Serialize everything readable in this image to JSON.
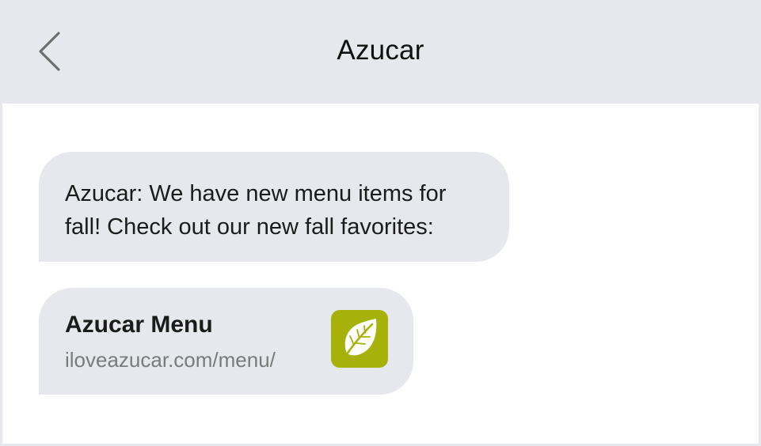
{
  "header": {
    "title": "Azucar",
    "back_icon": "chevron-left-icon"
  },
  "messages": [
    {
      "type": "text",
      "text": "Azucar: We have new menu items for fall! Check out our new fall favorites:"
    },
    {
      "type": "link-preview",
      "title": "Azucar Menu",
      "url": "iloveazucar.com/menu/",
      "icon": "leaf-icon",
      "icon_bg": "#a6b20a"
    }
  ],
  "colors": {
    "header_bg": "#e6e8ed",
    "bubble_bg": "#e6e8ed",
    "text": "#1b1b1b",
    "url_text": "#7a7a7a"
  }
}
